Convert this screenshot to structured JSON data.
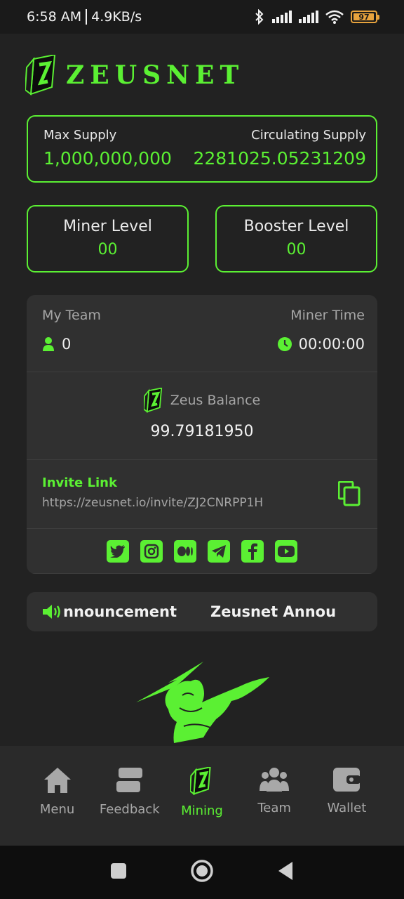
{
  "status_bar": {
    "time": "6:58 AM",
    "speed": "4.9KB/s",
    "battery": "97"
  },
  "brand": {
    "name": "ZEUSNET",
    "accent": "#5bf033"
  },
  "supply": {
    "max_label": "Max Supply",
    "max_value": "1,000,000,000",
    "circ_label": "Circulating Supply",
    "circ_value": "2281025.05231209"
  },
  "levels": {
    "miner_label": "Miner Level",
    "miner_value": "00",
    "booster_label": "Booster Level",
    "booster_value": "00"
  },
  "team": {
    "label": "My Team",
    "count": "0",
    "time_label": "Miner Time",
    "time_value": "00:00:00"
  },
  "balance": {
    "label": "Zeus Balance",
    "amount": "99.79181950"
  },
  "invite": {
    "label": "Invite Link",
    "url": "https://zeusnet.io/invite/ZJ2CNRPP1H"
  },
  "socials": [
    "twitter-icon",
    "instagram-icon",
    "medium-icon",
    "telegram-icon",
    "facebook-icon",
    "youtube-icon"
  ],
  "announcement": {
    "text_a": "nnouncement",
    "text_b": "Zeusnet Announc"
  },
  "nav": [
    {
      "label": "Menu",
      "icon": "home-icon"
    },
    {
      "label": "Feedback",
      "icon": "feedback-icon"
    },
    {
      "label": "Mining",
      "icon": "mining-icon",
      "active": true
    },
    {
      "label": "Team",
      "icon": "team-icon"
    },
    {
      "label": "Wallet",
      "icon": "wallet-icon"
    }
  ]
}
